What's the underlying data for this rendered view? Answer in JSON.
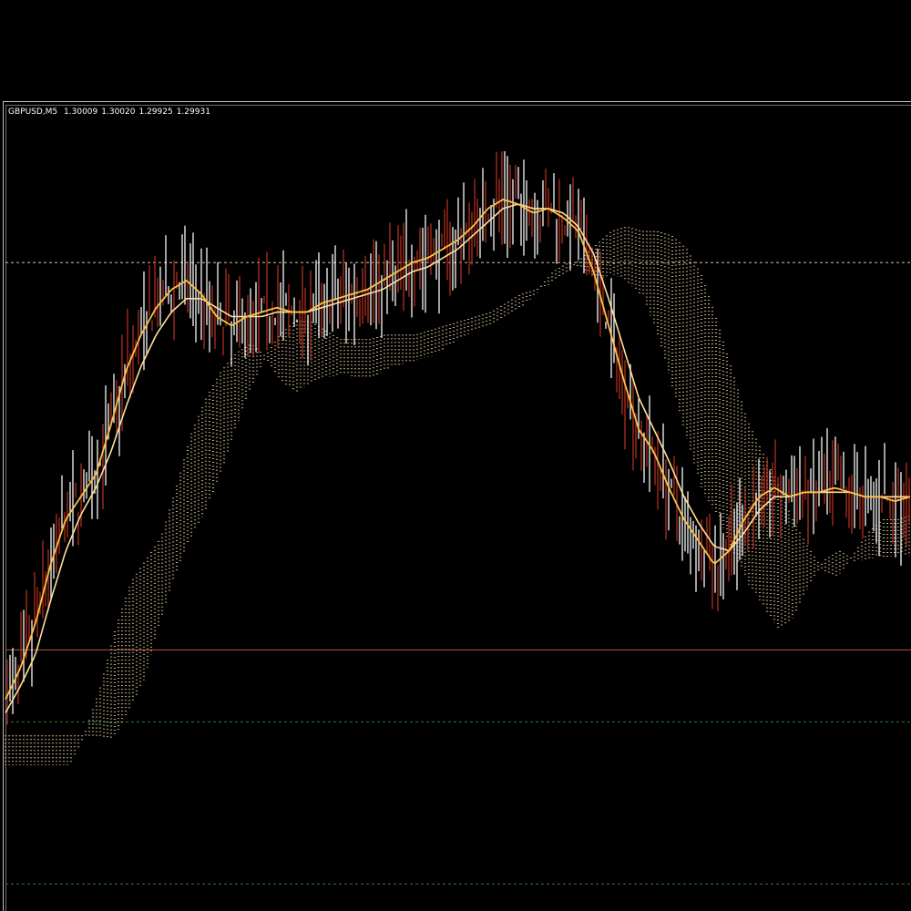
{
  "chart_header": {
    "symbol_timeframe": "GBPUSD,M5",
    "open": "1.30009",
    "high": "1.30020",
    "low": "1.29925",
    "close": "1.29931"
  },
  "colors": {
    "background": "#000000",
    "frame": "#bdbdbd",
    "text": "#ffffff",
    "bull_bar": "#ffffff",
    "bear_bar": "#b5301f",
    "fast_ma": "#ffc04a",
    "slow_ma": "#ffdf9a",
    "cloud": "#d9c39a",
    "dotted_level_upper": "#d9c39a",
    "solid_level": "#b05a3a",
    "dotted_level_lower": "#2e7d32"
  },
  "chart_data": {
    "type": "line",
    "instrument": "GBPUSD",
    "timeframe": "M5",
    "ohlc_last": {
      "open": 1.30009,
      "high": 1.3002,
      "low": 1.29925,
      "close": 1.29931
    },
    "series": [
      {
        "values": [
          0.05,
          0.12,
          0.22,
          0.35,
          0.45,
          0.5,
          0.55,
          0.66,
          0.78,
          0.86,
          0.92,
          0.96,
          0.98,
          0.95,
          0.9,
          0.88,
          0.9,
          0.91,
          0.92,
          0.91,
          0.91,
          0.93,
          0.94,
          0.95,
          0.96,
          0.98,
          1.0,
          1.02,
          1.03,
          1.05,
          1.07,
          1.1,
          1.14,
          1.16,
          1.15,
          1.13,
          1.14,
          1.12,
          1.09,
          1.0,
          0.88,
          0.76,
          0.65,
          0.6,
          0.52,
          0.45,
          0.4,
          0.35,
          0.38,
          0.45,
          0.5,
          0.52,
          0.5,
          0.51,
          0.51,
          0.52,
          0.51,
          0.5,
          0.5,
          0.49,
          0.5
        ]
      },
      {
        "values": [
          0.02,
          0.08,
          0.15,
          0.27,
          0.38,
          0.46,
          0.52,
          0.6,
          0.7,
          0.79,
          0.86,
          0.91,
          0.94,
          0.94,
          0.92,
          0.9,
          0.9,
          0.9,
          0.91,
          0.91,
          0.91,
          0.92,
          0.93,
          0.94,
          0.95,
          0.96,
          0.98,
          1.0,
          1.01,
          1.03,
          1.05,
          1.08,
          1.11,
          1.14,
          1.15,
          1.14,
          1.14,
          1.13,
          1.1,
          1.04,
          0.94,
          0.83,
          0.72,
          0.65,
          0.58,
          0.5,
          0.44,
          0.39,
          0.38,
          0.42,
          0.47,
          0.5,
          0.5,
          0.51,
          0.51,
          0.51,
          0.51,
          0.5,
          0.5,
          0.5,
          0.5
        ]
      }
    ],
    "levels": [
      {
        "style": "dotted",
        "value": 1.02
      },
      {
        "style": "solid",
        "value": 0.16
      },
      {
        "style": "dotted",
        "value": 0.0
      },
      {
        "style": "dotted",
        "value": -0.36
      }
    ],
    "ylim": [
      -0.42,
      1.33
    ],
    "grid": false
  }
}
